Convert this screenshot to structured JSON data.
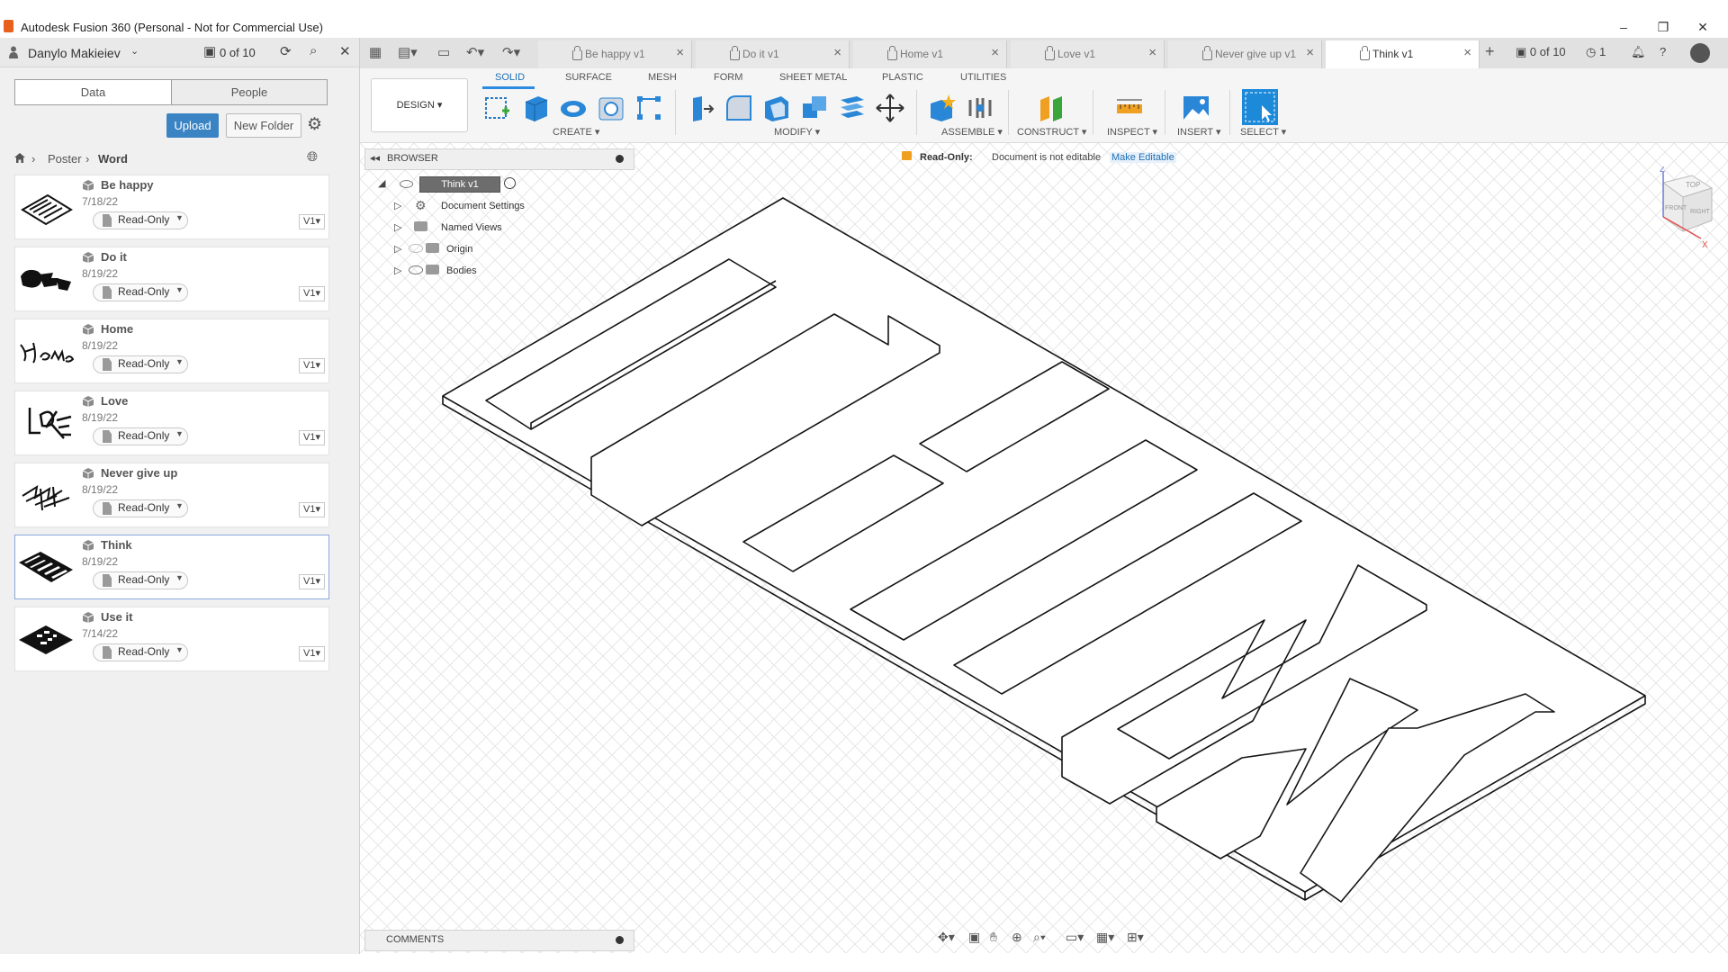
{
  "window": {
    "title": "Autodesk Fusion 360 (Personal - Not for Commercial Use)",
    "minimize": "–",
    "restore": "❐",
    "close": "✕"
  },
  "datapanel": {
    "user_name": "Danylo Makieiev",
    "doc_count": "0 of 10",
    "tabs": {
      "data": "Data",
      "people": "People"
    },
    "upload_label": "Upload",
    "new_folder_label": "New Folder",
    "breadcrumb": {
      "level1": "Poster",
      "level2": "Word",
      "sep": "›"
    },
    "files": [
      {
        "name": "Be happy",
        "date": "7/18/22",
        "access": "Read-Only",
        "version": "V1"
      },
      {
        "name": "Do it",
        "date": "8/19/22",
        "access": "Read-Only",
        "version": "V1"
      },
      {
        "name": "Home",
        "date": "8/19/22",
        "access": "Read-Only",
        "version": "V1"
      },
      {
        "name": "Love",
        "date": "8/19/22",
        "access": "Read-Only",
        "version": "V1"
      },
      {
        "name": "Never give up",
        "date": "8/19/22",
        "access": "Read-Only",
        "version": "V1"
      },
      {
        "name": "Think",
        "date": "8/19/22",
        "access": "Read-Only",
        "version": "V1"
      },
      {
        "name": "Use it",
        "date": "7/14/22",
        "access": "Read-Only",
        "version": "V1"
      }
    ]
  },
  "doc_tabs": [
    {
      "label": "Be happy v1"
    },
    {
      "label": "Do it v1"
    },
    {
      "label": "Home v1"
    },
    {
      "label": "Love v1"
    },
    {
      "label": "Never give up v1"
    },
    {
      "label": "Think v1"
    }
  ],
  "topright": {
    "jobs": "0 of 10",
    "clock_count": "1"
  },
  "ribbon": {
    "workspace": "DESIGN ▾",
    "tabs": [
      "SOLID",
      "SURFACE",
      "MESH",
      "FORM",
      "SHEET METAL",
      "PLASTIC",
      "UTILITIES"
    ],
    "groups": {
      "create": "CREATE ▾",
      "modify": "MODIFY ▾",
      "assemble": "ASSEMBLE ▾",
      "construct": "CONSTRUCT ▾",
      "inspect": "INSPECT ▾",
      "insert": "INSERT ▾",
      "select": "SELECT ▾"
    }
  },
  "browser": {
    "title": "BROWSER",
    "root": "Think v1",
    "items": [
      "Document Settings",
      "Named Views",
      "Origin",
      "Bodies"
    ]
  },
  "banner": {
    "label": "Read-Only:",
    "message": "Document is not editable",
    "action": "Make Editable"
  },
  "comments": {
    "title": "COMMENTS"
  },
  "viewcube": {
    "top": "TOP",
    "front": "FRONT",
    "right": "RIGHT",
    "z": "Z",
    "x": "X"
  },
  "colors": {
    "accent": "#2b8be0",
    "upload": "#3b84c4",
    "banner_icon": "#f0a020",
    "link": "#1f6fb3"
  }
}
